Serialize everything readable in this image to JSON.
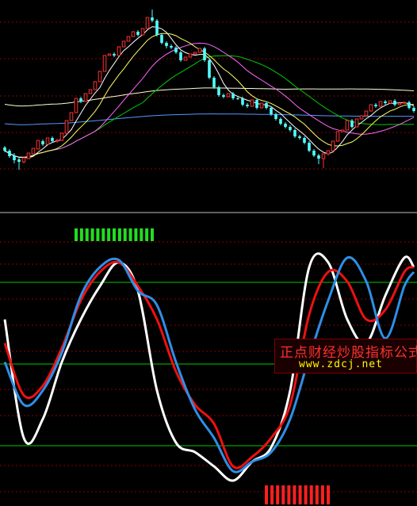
{
  "colors": {
    "background": "#000000",
    "grid_red": "#8b0000",
    "divider": "#c0c0c0",
    "level_green": "#00c800",
    "candle_up": "#ff3333",
    "candle_down": "#54ffff",
    "ma5": "#ffffff",
    "ma10": "#ffff66",
    "ma20": "#ff66ff",
    "ma30": "#00cc00",
    "ma60": "#ffffcc",
    "ma120": "#5599ff",
    "k_line": "#ffffff",
    "d_line": "#ee1111",
    "j_line": "#2e8fe8",
    "buy_marker": "#ff2020",
    "sell_marker": "#22dd22"
  },
  "watermark": {
    "title": "正点财经炒股指标公式",
    "url": "www.zdcj.net"
  },
  "chart_data": [
    {
      "type": "candlestick",
      "panel": "price",
      "title": "",
      "xlabel": "",
      "ylabel": "",
      "grid": true,
      "x": [
        0,
        1,
        2,
        3,
        4,
        5,
        6,
        7,
        8,
        9,
        10,
        11,
        12,
        13,
        14,
        15,
        16,
        17,
        18,
        19,
        20,
        21,
        22,
        23,
        24,
        25,
        26,
        27,
        28,
        29,
        30,
        31,
        32,
        33,
        34,
        35,
        36,
        37,
        38,
        39,
        40,
        41,
        42,
        43,
        44,
        45,
        46,
        47,
        48,
        49,
        50,
        51,
        52,
        53,
        54,
        55,
        56,
        57,
        58,
        59,
        60,
        61,
        62,
        63,
        64,
        65,
        66,
        67,
        68,
        69,
        70,
        71,
        72,
        73,
        74,
        75,
        76,
        77,
        78,
        79,
        80,
        81,
        82,
        83,
        84,
        85,
        86
      ],
      "open": [
        186,
        190,
        196,
        201,
        204,
        200,
        194,
        188,
        178,
        182,
        174,
        178,
        177,
        168,
        152,
        142,
        124,
        128,
        118,
        113,
        103,
        90,
        70,
        68,
        70,
        59,
        52,
        46,
        40,
        44,
        36,
        22,
        26,
        44,
        54,
        58,
        60,
        66,
        76,
        72,
        68,
        66,
        61,
        76,
        98,
        110,
        120,
        122,
        118,
        124,
        124,
        132,
        134,
        126,
        136,
        130,
        136,
        144,
        150,
        156,
        160,
        164,
        172,
        174,
        180,
        190,
        196,
        200,
        194,
        190,
        178,
        166,
        164,
        152,
        160,
        150,
        146,
        140,
        132,
        134,
        128,
        130,
        127,
        132,
        130,
        129,
        136
      ],
      "close": [
        190,
        197,
        202,
        204,
        199,
        193,
        187,
        177,
        182,
        174,
        178,
        177,
        168,
        152,
        142,
        124,
        128,
        118,
        113,
        103,
        90,
        70,
        68,
        70,
        59,
        52,
        46,
        40,
        44,
        36,
        22,
        26,
        44,
        54,
        58,
        60,
        66,
        76,
        72,
        68,
        66,
        61,
        76,
        98,
        110,
        120,
        122,
        118,
        124,
        124,
        132,
        134,
        126,
        136,
        130,
        136,
        144,
        150,
        156,
        160,
        164,
        172,
        174,
        180,
        190,
        196,
        200,
        194,
        190,
        178,
        166,
        164,
        152,
        160,
        150,
        146,
        140,
        132,
        134,
        128,
        130,
        127,
        132,
        130,
        129,
        136,
        140
      ],
      "high": [
        184,
        188,
        193,
        198,
        202,
        198,
        192,
        186,
        176,
        180,
        172,
        175,
        175,
        165,
        150,
        140,
        122,
        126,
        116,
        111,
        100,
        88,
        68,
        66,
        68,
        57,
        50,
        44,
        38,
        42,
        34,
        12,
        24,
        42,
        52,
        56,
        58,
        64,
        74,
        70,
        66,
        64,
        59,
        74,
        96,
        108,
        118,
        120,
        116,
        122,
        122,
        130,
        132,
        124,
        134,
        128,
        134,
        142,
        148,
        154,
        158,
        162,
        170,
        172,
        178,
        188,
        194,
        198,
        192,
        188,
        176,
        164,
        162,
        150,
        158,
        148,
        144,
        138,
        130,
        132,
        126,
        128,
        125,
        130,
        128,
        127,
        134
      ],
      "low": [
        192,
        199,
        206,
        214,
        206,
        195,
        190,
        180,
        184,
        176,
        180,
        180,
        170,
        154,
        145,
        126,
        130,
        120,
        115,
        105,
        93,
        72,
        70,
        72,
        61,
        54,
        48,
        42,
        46,
        38,
        24,
        28,
        46,
        56,
        61,
        62,
        68,
        78,
        74,
        71,
        68,
        63,
        78,
        100,
        112,
        122,
        124,
        120,
        126,
        126,
        134,
        136,
        128,
        138,
        132,
        138,
        146,
        152,
        158,
        162,
        166,
        174,
        176,
        182,
        192,
        198,
        207,
        212,
        196,
        180,
        168,
        166,
        154,
        162,
        152,
        148,
        142,
        134,
        136,
        130,
        132,
        129,
        134,
        132,
        131,
        138,
        142
      ],
      "note": "values are price-panel scale units (top of panel = 0, larger = lower price); no price axis labels are printed"
    },
    {
      "type": "line",
      "panel": "indicator",
      "title": "",
      "xlabel": "",
      "ylabel": "",
      "ylim": [
        0,
        100
      ],
      "levels": [
        80,
        50,
        20
      ],
      "x": [
        0,
        4,
        8,
        12,
        16,
        20,
        24,
        28,
        32,
        36,
        40,
        44,
        48,
        52,
        56,
        60,
        64,
        68,
        72,
        76,
        80,
        84,
        86
      ],
      "series": [
        {
          "key": "K",
          "values": [
            70,
            20,
            28,
            52,
            70,
            84,
            94,
            82,
            40,
            18,
            14,
            8,
            2,
            10,
            16,
            40,
            92,
            94,
            70,
            60,
            80,
            96,
            92
          ]
        },
        {
          "key": "D",
          "values": [
            60,
            38,
            42,
            58,
            78,
            90,
            94,
            84,
            70,
            48,
            34,
            26,
            8,
            12,
            20,
            34,
            72,
            90,
            86,
            70,
            74,
            90,
            92
          ]
        },
        {
          "key": "J",
          "values": [
            52,
            34,
            40,
            56,
            80,
            92,
            95,
            82,
            76,
            52,
            32,
            20,
            6,
            10,
            14,
            28,
            54,
            78,
            96,
            86,
            62,
            84,
            90
          ]
        }
      ],
      "signals": {
        "sell": {
          "x_start": 15,
          "x_end": 31,
          "bars": 15
        },
        "buy": {
          "x_start": 55,
          "x_end": 68,
          "bars": 12
        }
      }
    }
  ]
}
